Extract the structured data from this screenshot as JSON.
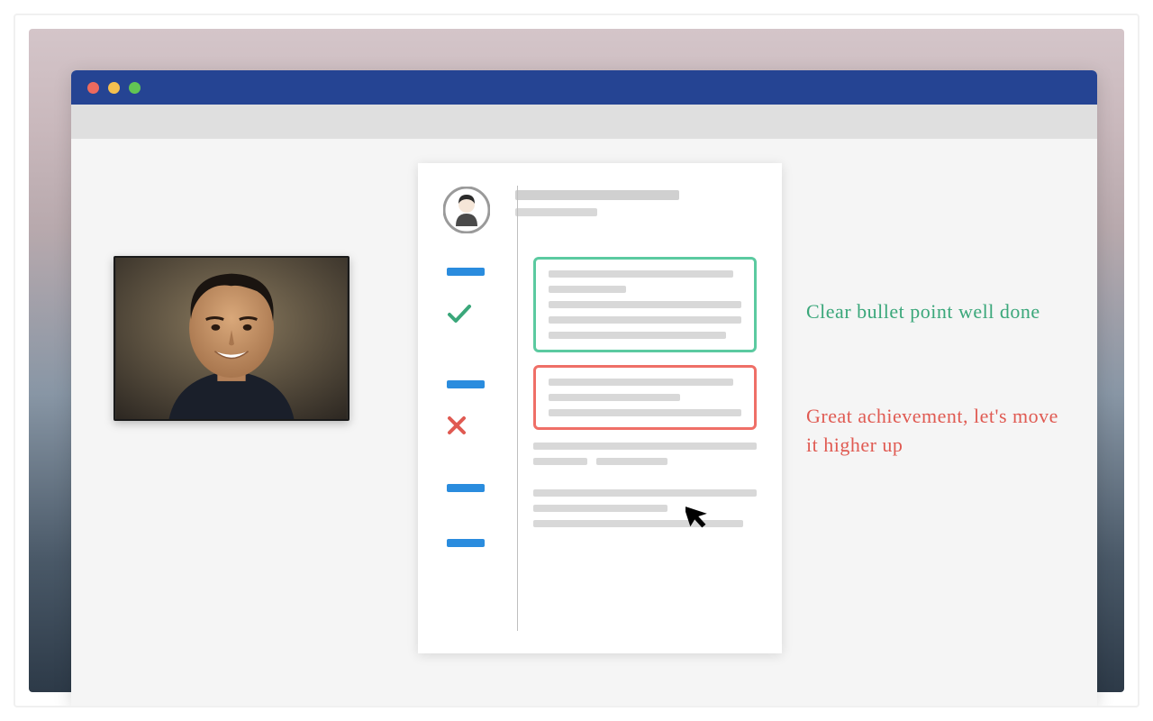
{
  "annotations": {
    "positive": "Clear bullet point well done",
    "suggestion": "Great achievement, let's move it higher up"
  },
  "colors": {
    "titlebar": "#254493",
    "accent": "#2a8cde",
    "positive": "#5bcaa0",
    "negative": "#ef6f67"
  },
  "icons": {
    "check": "check-icon",
    "cross": "x-icon",
    "cursor": "cursor-icon"
  }
}
